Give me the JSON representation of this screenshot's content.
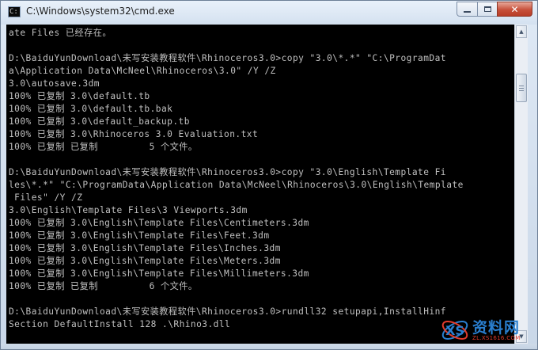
{
  "window": {
    "title": "C:\\Windows\\system32\\cmd.exe",
    "app_icon": "cmd-icon",
    "controls": {
      "minimize": "minimize-icon",
      "maximize": "maximize-icon",
      "close": "close-icon"
    }
  },
  "console": {
    "background": "#000000",
    "foreground": "#c0c0c0",
    "lines": [
      "ate Files 已经存在。",
      "",
      "D:\\BaiduYunDownload\\未写安装教程软件\\Rhinoceros3.0>copy \"3.0\\*.*\" \"C:\\ProgramDat",
      "a\\Application Data\\McNeel\\Rhinoceros\\3.0\" /Y /Z",
      "3.0\\autosave.3dm",
      "100% 已复制 3.0\\default.tb",
      "100% 已复制 3.0\\default.tb.bak",
      "100% 已复制 3.0\\default_backup.tb",
      "100% 已复制 3.0\\Rhinoceros 3.0 Evaluation.txt",
      "100% 已复制 已复制         5 个文件。",
      "",
      "D:\\BaiduYunDownload\\未写安装教程软件\\Rhinoceros3.0>copy \"3.0\\English\\Template Fi",
      "les\\*.*\" \"C:\\ProgramData\\Application Data\\McNeel\\Rhinoceros\\3.0\\English\\Template",
      " Files\" /Y /Z",
      "3.0\\English\\Template Files\\3 Viewports.3dm",
      "100% 已复制 3.0\\English\\Template Files\\Centimeters.3dm",
      "100% 已复制 3.0\\English\\Template Files\\Feet.3dm",
      "100% 已复制 3.0\\English\\Template Files\\Inches.3dm",
      "100% 已复制 3.0\\English\\Template Files\\Meters.3dm",
      "100% 已复制 3.0\\English\\Template Files\\Millimeters.3dm",
      "100% 已复制 已复制         6 个文件。",
      "",
      "D:\\BaiduYunDownload\\未写安装教程软件\\Rhinoceros3.0>rundll32 setupapi,InstallHinf",
      "Section DefaultInstall 128 .\\Rhino3.dll"
    ]
  },
  "scrollbar": {
    "up_icon": "arrow-up-icon",
    "down_icon": "arrow-down-icon"
  },
  "watermark": {
    "name": "资料网",
    "url": "ZL.XS1616.COM",
    "accent": "#2a7fd0",
    "url_color": "#e23b2c"
  }
}
